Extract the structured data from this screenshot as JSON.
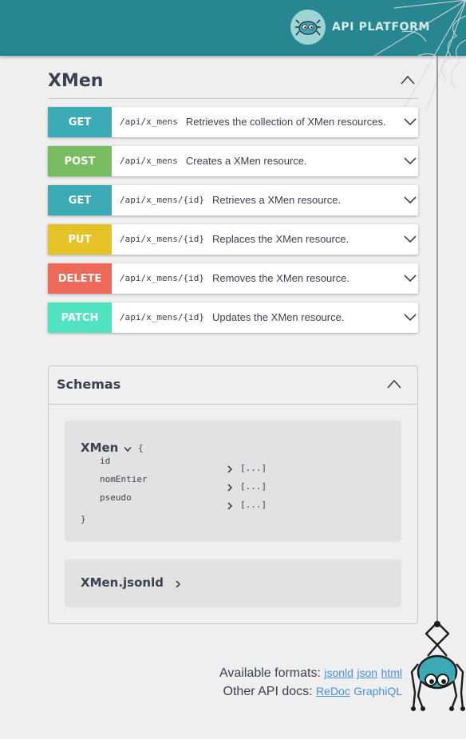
{
  "header": {
    "logo_text": "API PLATFORM",
    "bar_color": "#288690"
  },
  "resource": {
    "title": "XMen"
  },
  "operations": [
    {
      "method": "GET",
      "path": "/api/x_mens",
      "summary": "Retrieves the collection of XMen resources.",
      "color": "#3caab5"
    },
    {
      "method": "POST",
      "path": "/api/x_mens",
      "summary": "Creates a XMen resource.",
      "color": "#78bc61"
    },
    {
      "method": "GET",
      "path": "/api/x_mens/{id}",
      "summary": "Retrieves a XMen resource.",
      "color": "#3caab5"
    },
    {
      "method": "PUT",
      "path": "/api/x_mens/{id}",
      "summary": "Replaces the XMen resource.",
      "color": "#e6c229"
    },
    {
      "method": "DELETE",
      "path": "/api/x_mens/{id}",
      "summary": "Removes the XMen resource.",
      "color": "#ed6a5a"
    },
    {
      "method": "PATCH",
      "path": "/api/x_mens/{id}",
      "summary": "Updates the XMen resource.",
      "color": "#50e3c2"
    }
  ],
  "schemas": {
    "title": "Schemas",
    "models": [
      {
        "name": "XMen",
        "open_brace": "{",
        "close_brace": "}",
        "properties": [
          {
            "name": "id",
            "value": "[...]"
          },
          {
            "name": "nomEntier",
            "value": "[...]"
          },
          {
            "name": "pseudo",
            "value": "[...]"
          }
        ]
      },
      {
        "name": "XMen.jsonld"
      }
    ]
  },
  "footer": {
    "formats_label": "Available formats:",
    "formats": [
      "jsonld",
      "json",
      "html"
    ],
    "docs_label": "Other API docs:",
    "docs": [
      "ReDoc",
      "GraphiQL"
    ]
  }
}
